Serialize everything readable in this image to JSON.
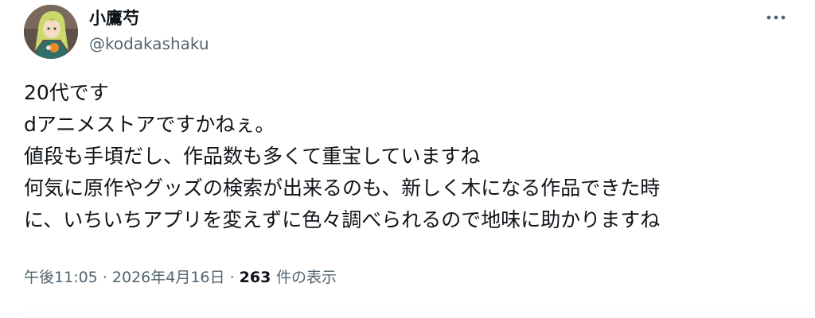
{
  "author": {
    "display_name": "小鷹芍",
    "handle": "@kodakashaku",
    "avatar_icon": "anime-character-avatar"
  },
  "more_icon": "more-horizontal-icon",
  "tweet": {
    "lines": [
      "20代です",
      "dアニメストアですかねぇ。",
      "値段も手頃だし、作品数も多くて重宝していますね",
      "何気に原作やグッズの検索が出来るのも、新しく木になる作品できた時",
      "に、いちいちアプリを変えずに色々調べられるので地味に助かりますね"
    ]
  },
  "meta": {
    "time": "午後11:05",
    "separator": "·",
    "date": "2026年4月16日",
    "views_count": "263",
    "views_label": "件の表示"
  },
  "colors": {
    "text_primary": "#0f1419",
    "text_secondary": "#536471",
    "divider": "#eff3f4"
  }
}
